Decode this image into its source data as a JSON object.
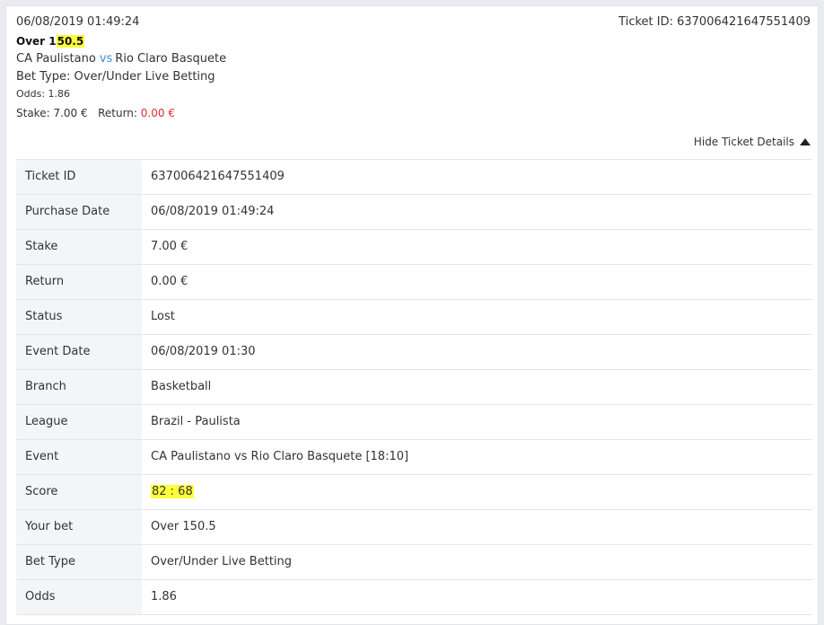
{
  "header": {
    "date": "06/08/2019 01:49:24",
    "ticket_id_text": "Ticket ID: 637006421647551409",
    "selection_prefix": "Over 1",
    "selection_highlight": "50.5",
    "home_team": "CA Paulistano",
    "vs": "vs",
    "away_team": "Rio Claro Basquete",
    "bet_type": "Bet Type: Over/Under Live Betting",
    "odds": "Odds: 1.86",
    "stake_label": "Stake:",
    "stake_value": "7.00 €",
    "return_label": "Return:",
    "return_value": "0.00 €"
  },
  "toggle": {
    "label": "Hide Ticket Details",
    "icon": "caret-up-icon"
  },
  "details": {
    "ticket_id": {
      "label": "Ticket ID",
      "value": "637006421647551409"
    },
    "purchase_date": {
      "label": "Purchase Date",
      "value": "06/08/2019 01:49:24"
    },
    "stake": {
      "label": "Stake",
      "value": "7.00 €"
    },
    "return": {
      "label": "Return",
      "value": "0.00 €"
    },
    "status": {
      "label": "Status",
      "value": "Lost"
    },
    "event_date": {
      "label": "Event Date",
      "value": "06/08/2019 01:30"
    },
    "branch": {
      "label": "Branch",
      "value": "Basketball"
    },
    "league": {
      "label": "League",
      "value": "Brazil - Paulista"
    },
    "event": {
      "label": "Event",
      "value": "CA Paulistano vs Rio Claro Basquete [18:10]"
    },
    "score": {
      "label": "Score",
      "value": "82 : 68"
    },
    "your_bet": {
      "label": "Your bet",
      "value": "Over 150.5"
    },
    "bet_type": {
      "label": "Bet Type",
      "value": "Over/Under Live Betting"
    },
    "odds": {
      "label": "Odds",
      "value": "1.86"
    }
  },
  "colors": {
    "highlight": "#ffff3a",
    "negative": "#e02d2d",
    "vs_accent": "#3a8fd1",
    "label_bg": "#f4f5f7"
  }
}
